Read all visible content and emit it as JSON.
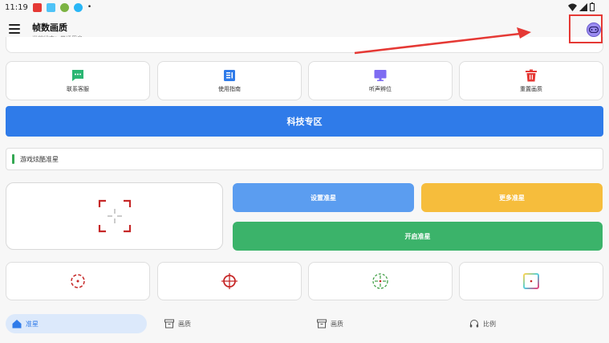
{
  "status_bar": {
    "time": "11:19"
  },
  "app_bar": {
    "title": "帧数画质",
    "subtitle": "当前状态：普通用户"
  },
  "features": [
    {
      "label": "联系客服",
      "icon": "message-icon",
      "color": "#2bb673"
    },
    {
      "label": "使用指南",
      "icon": "guide-icon",
      "color": "#2f7be9"
    },
    {
      "label": "听声辨位",
      "icon": "monitor-icon",
      "color": "#7e6cf2"
    },
    {
      "label": "重置画质",
      "icon": "trash-icon",
      "color": "#e53935"
    }
  ],
  "tech_zone_label": "科技专区",
  "notice_text": "游戏炫酷准星",
  "actions": {
    "set_label": "设置准星",
    "more_label": "更多准星",
    "open_label": "开启准星"
  },
  "crosshair_styles": [
    {
      "icon": "crosshair-dotted-circle-icon",
      "color": "#c62828"
    },
    {
      "icon": "crosshair-scope-icon",
      "color": "#c62828"
    },
    {
      "icon": "crosshair-green-circle-icon",
      "color": "#43a047"
    },
    {
      "icon": "crosshair-gradient-square-icon",
      "color": "#ffb300"
    }
  ],
  "bottom_nav": [
    {
      "label": "准星",
      "icon": "home-icon",
      "active": true
    },
    {
      "label": "画质",
      "icon": "archive-icon",
      "active": false
    },
    {
      "label": "画质",
      "icon": "archive-icon",
      "active": false
    },
    {
      "label": "比例",
      "icon": "headset-icon",
      "active": false
    }
  ],
  "colors": {
    "accent": "#2f7be9",
    "set_button": "#5b9df0",
    "more_button": "#f6bd3c",
    "open_button": "#3bb36a",
    "annotation": "#e53935"
  }
}
